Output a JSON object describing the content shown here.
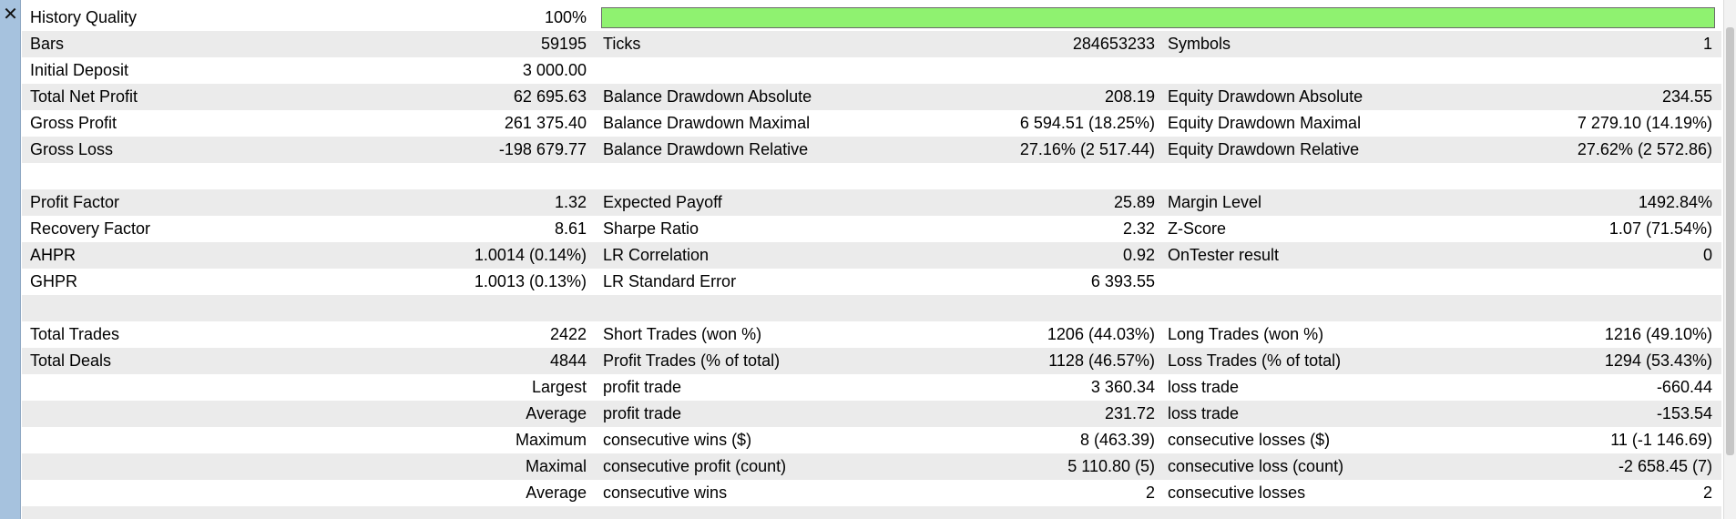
{
  "close_icon_glyph": "✕",
  "quality_fill_color": "#8ff270",
  "history_quality": {
    "label": "History Quality",
    "value": "100%",
    "fraction": 1.0
  },
  "rows": [
    {
      "alt": true,
      "l1": "Bars",
      "v1": "59195",
      "l2": "Ticks",
      "v2": "284653233",
      "l3": "Symbols",
      "v3": "1"
    },
    {
      "alt": false,
      "l1": "Initial Deposit",
      "v1": "3 000.00",
      "l2": "",
      "v2": "",
      "l3": "",
      "v3": ""
    },
    {
      "alt": true,
      "l1": "Total Net Profit",
      "v1": "62 695.63",
      "l2": "Balance Drawdown Absolute",
      "v2": "208.19",
      "l3": "Equity Drawdown Absolute",
      "v3": "234.55"
    },
    {
      "alt": false,
      "l1": "Gross Profit",
      "v1": "261 375.40",
      "l2": "Balance Drawdown Maximal",
      "v2": "6 594.51 (18.25%)",
      "l3": "Equity Drawdown Maximal",
      "v3": "7 279.10 (14.19%)"
    },
    {
      "alt": true,
      "l1": "Gross Loss",
      "v1": "-198 679.77",
      "l2": "Balance Drawdown Relative",
      "v2": "27.16% (2 517.44)",
      "l3": "Equity Drawdown Relative",
      "v3": "27.62% (2 572.86)"
    },
    {
      "alt": false,
      "l1": "",
      "v1": "",
      "l2": "",
      "v2": "",
      "l3": "",
      "v3": ""
    },
    {
      "alt": true,
      "l1": "Profit Factor",
      "v1": "1.32",
      "l2": "Expected Payoff",
      "v2": "25.89",
      "l3": "Margin Level",
      "v3": "1492.84%"
    },
    {
      "alt": false,
      "l1": "Recovery Factor",
      "v1": "8.61",
      "l2": "Sharpe Ratio",
      "v2": "2.32",
      "l3": "Z-Score",
      "v3": "1.07 (71.54%)"
    },
    {
      "alt": true,
      "l1": "AHPR",
      "v1": "1.0014 (0.14%)",
      "l2": "LR Correlation",
      "v2": "0.92",
      "l3": "OnTester result",
      "v3": "0"
    },
    {
      "alt": false,
      "l1": "GHPR",
      "v1": "1.0013 (0.13%)",
      "l2": "LR Standard Error",
      "v2": "6 393.55",
      "l3": "",
      "v3": ""
    },
    {
      "alt": true,
      "l1": "",
      "v1": "",
      "l2": "",
      "v2": "",
      "l3": "",
      "v3": ""
    },
    {
      "alt": false,
      "l1": "Total Trades",
      "v1": "2422",
      "l2": "Short Trades (won %)",
      "v2": "1206 (44.03%)",
      "l3": "Long Trades (won %)",
      "v3": "1216 (49.10%)"
    },
    {
      "alt": true,
      "l1": "Total Deals",
      "v1": "4844",
      "l2": "Profit Trades (% of total)",
      "v2": "1128 (46.57%)",
      "l3": "Loss Trades (% of total)",
      "v3": "1294 (53.43%)"
    },
    {
      "alt": false,
      "l1": "",
      "v1": "Largest",
      "l2": "profit trade",
      "v2": "3 360.34",
      "l3": "loss trade",
      "v3": "-660.44"
    },
    {
      "alt": true,
      "l1": "",
      "v1": "Average",
      "l2": "profit trade",
      "v2": "231.72",
      "l3": "loss trade",
      "v3": "-153.54"
    },
    {
      "alt": false,
      "l1": "",
      "v1": "Maximum",
      "l2": "consecutive wins ($)",
      "v2": "8 (463.39)",
      "l3": "consecutive losses ($)",
      "v3": "11 (-1 146.69)"
    },
    {
      "alt": true,
      "l1": "",
      "v1": "Maximal",
      "l2": "consecutive profit (count)",
      "v2": "5 110.80 (5)",
      "l3": "consecutive loss (count)",
      "v3": "-2 658.45 (7)"
    },
    {
      "alt": false,
      "l1": "",
      "v1": "Average",
      "l2": "consecutive wins",
      "v2": "2",
      "l3": "consecutive losses",
      "v3": "2"
    },
    {
      "alt": true,
      "l1": "",
      "v1": "",
      "l2": "",
      "v2": "",
      "l3": "",
      "v3": ""
    }
  ]
}
